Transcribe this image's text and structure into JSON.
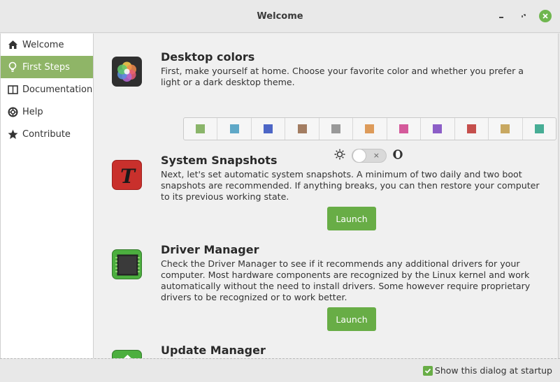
{
  "window": {
    "title": "Welcome"
  },
  "sidebar": {
    "items": [
      {
        "label": "Welcome",
        "icon": "home-icon",
        "active": false
      },
      {
        "label": "First Steps",
        "icon": "lightbulb-icon",
        "active": true
      },
      {
        "label": "Documentation",
        "icon": "book-icon",
        "active": false
      },
      {
        "label": "Help",
        "icon": "lifebuoy-icon",
        "active": false
      },
      {
        "label": "Contribute",
        "icon": "star-icon",
        "active": false
      }
    ]
  },
  "sections": {
    "colors": {
      "title": "Desktop colors",
      "description": "First, make yourself at home. Choose your favorite color and whether you prefer a light or a dark desktop theme.",
      "swatches": [
        "#8ab56a",
        "#5fa8c7",
        "#4d66c6",
        "#a37d62",
        "#999999",
        "#dd9b5a",
        "#d45a9b",
        "#8c5ec7",
        "#c54f4c",
        "#c8a861",
        "#47ad95"
      ],
      "dark_mode": false,
      "toggle_off_mark": "×"
    },
    "snapshots": {
      "title": "System Snapshots",
      "description": "Next, let's set automatic system snapshots. A minimum of two daily and two boot snapshots are recommended. If anything breaks, you can then restore your computer to its previous working state.",
      "button": "Launch"
    },
    "drivers": {
      "title": "Driver Manager",
      "description": "Check the Driver Manager to see if it recommends any additional drivers for your computer. Most hardware components are recognized by the Linux kernel and work automatically without the need to install drivers. Some however require proprietary drivers to be recognized or to work better.",
      "button": "Launch"
    },
    "updates": {
      "title": "Update Manager"
    }
  },
  "footer": {
    "startup_label": "Show this dialog at startup",
    "startup_checked": true
  },
  "colors": {
    "accent": "#8fb567",
    "button": "#68ad46"
  }
}
